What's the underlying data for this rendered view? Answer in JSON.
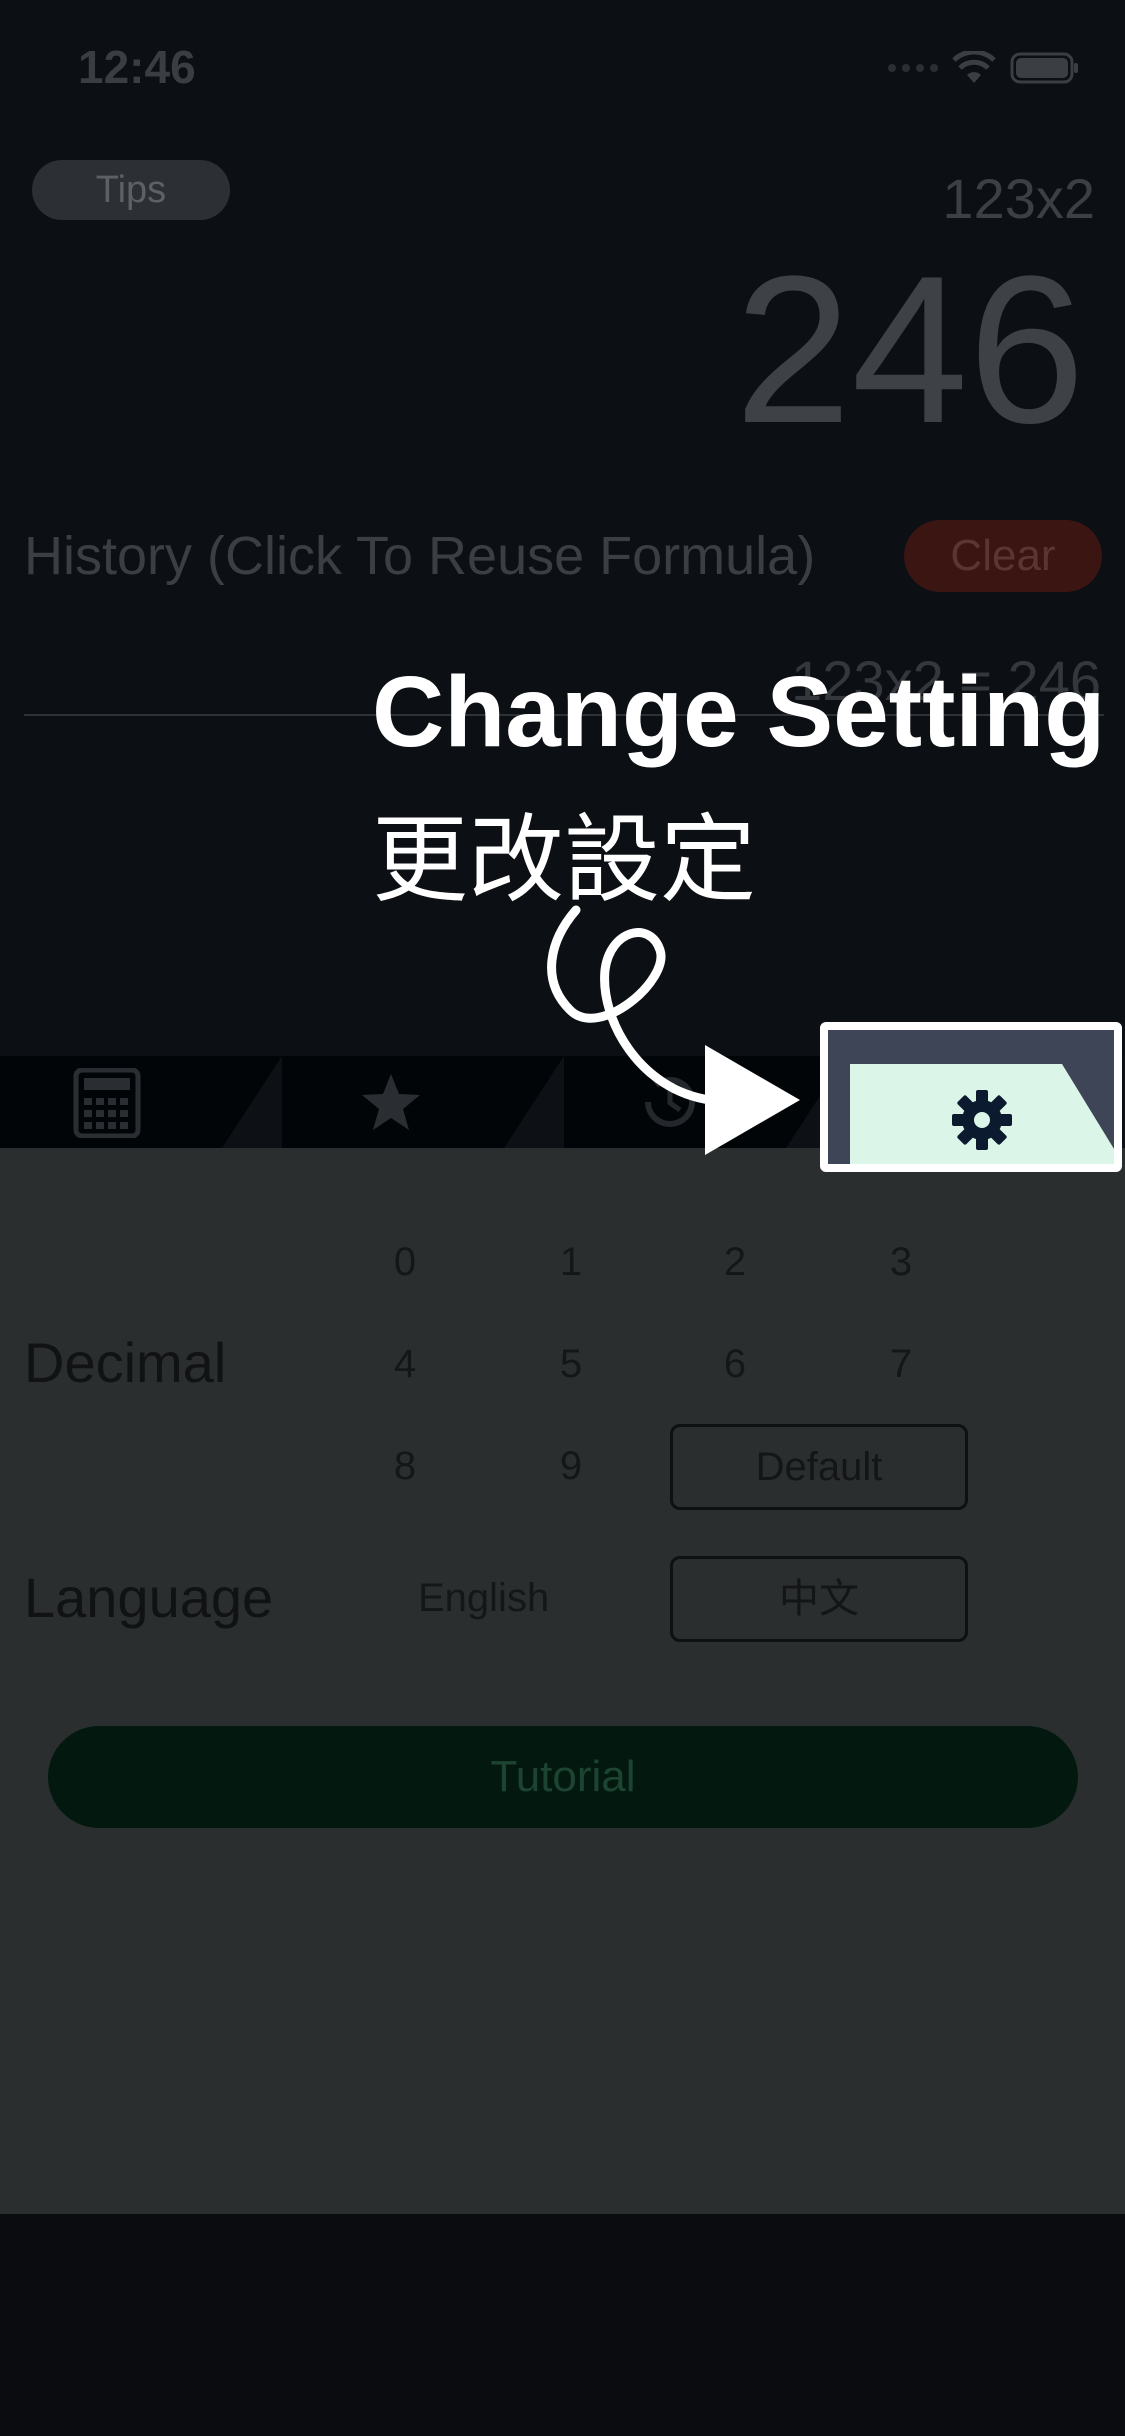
{
  "status_bar": {
    "time": "12:46",
    "icons": [
      "signal-dots-icon",
      "wifi-icon",
      "battery-icon"
    ]
  },
  "calculator": {
    "tips_label": "Tips",
    "formula": "123x2",
    "result": "246",
    "history_label": "History (Click To Reuse Formula)",
    "clear_label": "Clear",
    "history_items": [
      {
        "formula": "123x2",
        "result": "246",
        "display": "123x2 = 246"
      }
    ]
  },
  "tabs": [
    {
      "name": "calculator",
      "icon": "calculator-icon"
    },
    {
      "name": "favorites",
      "icon": "star-icon"
    },
    {
      "name": "history",
      "icon": "history-icon"
    },
    {
      "name": "settings",
      "icon": "gear-icon",
      "highlighted": true
    }
  ],
  "settings": {
    "decimal_label": "Decimal",
    "decimal_options": [
      "0",
      "1",
      "2",
      "3",
      "4",
      "5",
      "6",
      "7",
      "8",
      "9"
    ],
    "default_label": "Default",
    "language_label": "Language",
    "language_options": [
      "English",
      "中文"
    ],
    "tutorial_label": "Tutorial"
  },
  "overlay": {
    "title": "Change Setting",
    "subtitle": "更改設定"
  },
  "colors": {
    "overlay_text": "#ffffff",
    "settings_tab_highlight": "#dbf5e8",
    "gear_icon": "#0b1a2e",
    "tutorial_button": "#03190f",
    "clear_button": "#3a1512"
  }
}
